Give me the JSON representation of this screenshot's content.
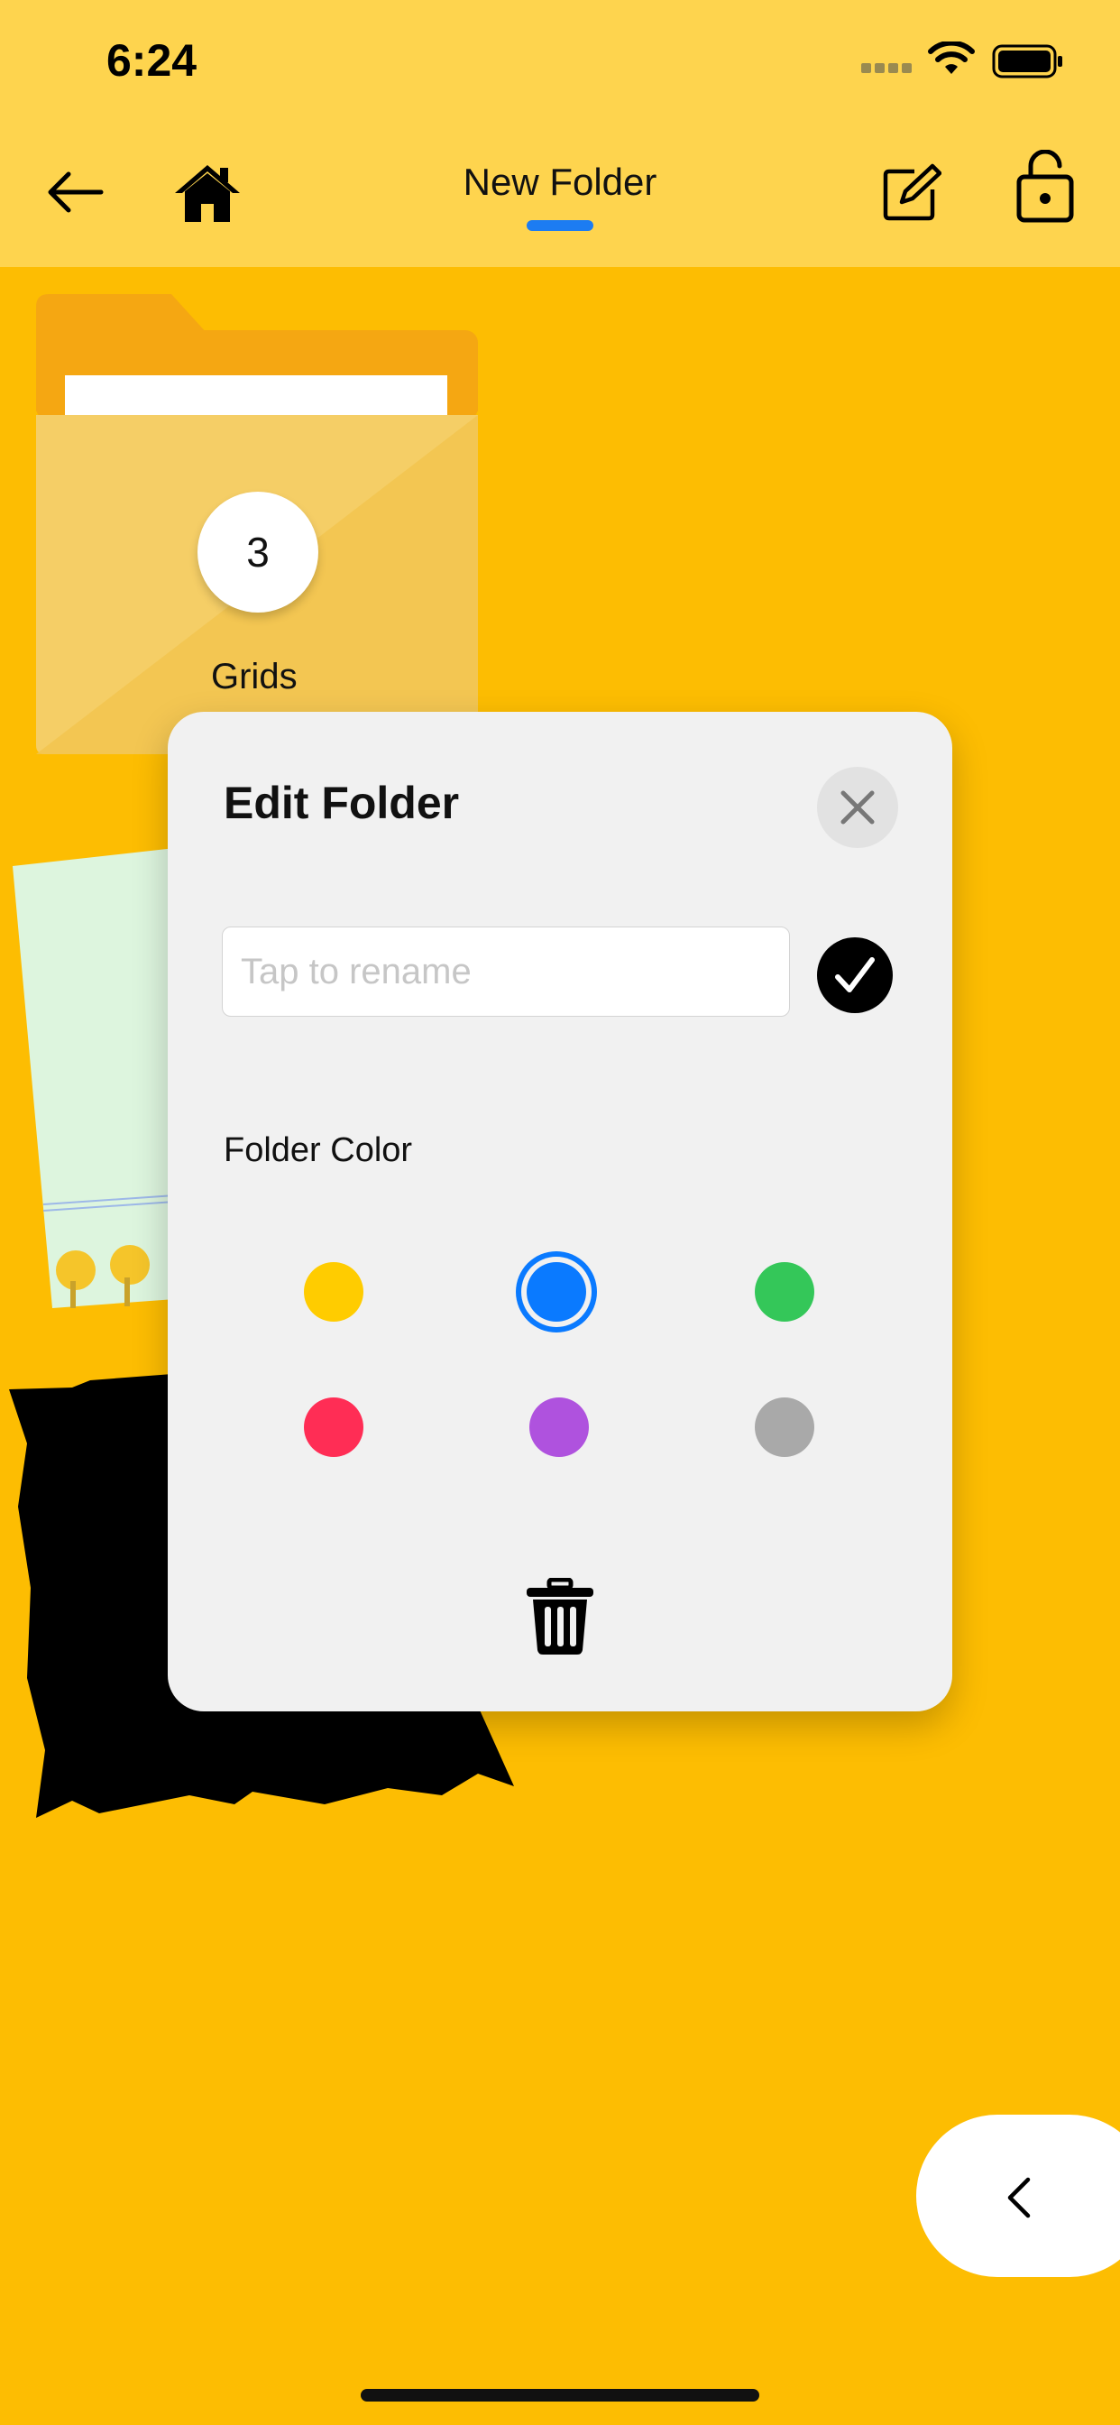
{
  "status_bar": {
    "time": "6:24"
  },
  "nav": {
    "title": "New Folder"
  },
  "folder_card": {
    "count": "3",
    "name": "Grids"
  },
  "edit_sheet": {
    "title": "Edit Folder",
    "rename_placeholder": "Tap to rename",
    "rename_value": "",
    "color_section_label": "Folder Color",
    "colors": [
      {
        "name": "yellow",
        "hex": "#FFCC00",
        "selected": false
      },
      {
        "name": "blue",
        "hex": "#0A7AFF",
        "selected": true
      },
      {
        "name": "green",
        "hex": "#34C759",
        "selected": false
      },
      {
        "name": "red",
        "hex": "#FF2D55",
        "selected": false
      },
      {
        "name": "purple",
        "hex": "#AF52DE",
        "selected": false
      },
      {
        "name": "gray",
        "hex": "#A9A9A9",
        "selected": false
      }
    ]
  },
  "icons": [
    "back-arrow-icon",
    "home-icon",
    "edit-icon",
    "unlock-icon",
    "close-icon",
    "checkmark-icon",
    "trash-icon",
    "chevron-left-icon"
  ],
  "theme": {
    "background": "#FDBD02",
    "header": "#FED44E",
    "accent": "#1C7CF2"
  }
}
